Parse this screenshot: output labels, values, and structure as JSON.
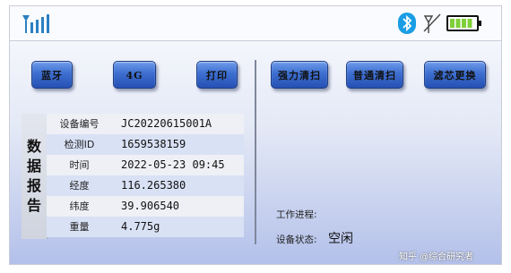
{
  "status_bar": {
    "bluetooth_icon": "bluetooth-icon",
    "no_signal_icon": "no-signal-icon",
    "battery_icon": "battery-full-icon",
    "signal_icon": "signal-strength-icon",
    "signal_bars": 5,
    "battery_level": 1.0,
    "battery_color": "#7fcf3a",
    "bluetooth_color": "#1a9de4"
  },
  "left_buttons": [
    {
      "label": "蓝牙"
    },
    {
      "label": "4G"
    },
    {
      "label": "打印"
    }
  ],
  "right_buttons": [
    {
      "label": "强力清扫"
    },
    {
      "label": "普通清扫"
    },
    {
      "label": "滤芯更换"
    }
  ],
  "report": {
    "title_chars": [
      "数",
      "据",
      "报",
      "告"
    ],
    "rows": [
      {
        "key": "设备编号",
        "value": "JC20220615001A"
      },
      {
        "key": "检测ID",
        "value": "1659538159"
      },
      {
        "key": "时间",
        "value": "2022-05-23 09:45"
      },
      {
        "key": "经度",
        "value": "116.265380"
      },
      {
        "key": "纬度",
        "value": "39.906540"
      },
      {
        "key": "重量",
        "value": "4.775g"
      }
    ]
  },
  "status": {
    "progress_label": "工作进程:",
    "state_label": "设备状态:",
    "state_value": "空闲"
  },
  "watermark": "知乎 @综合研究者"
}
